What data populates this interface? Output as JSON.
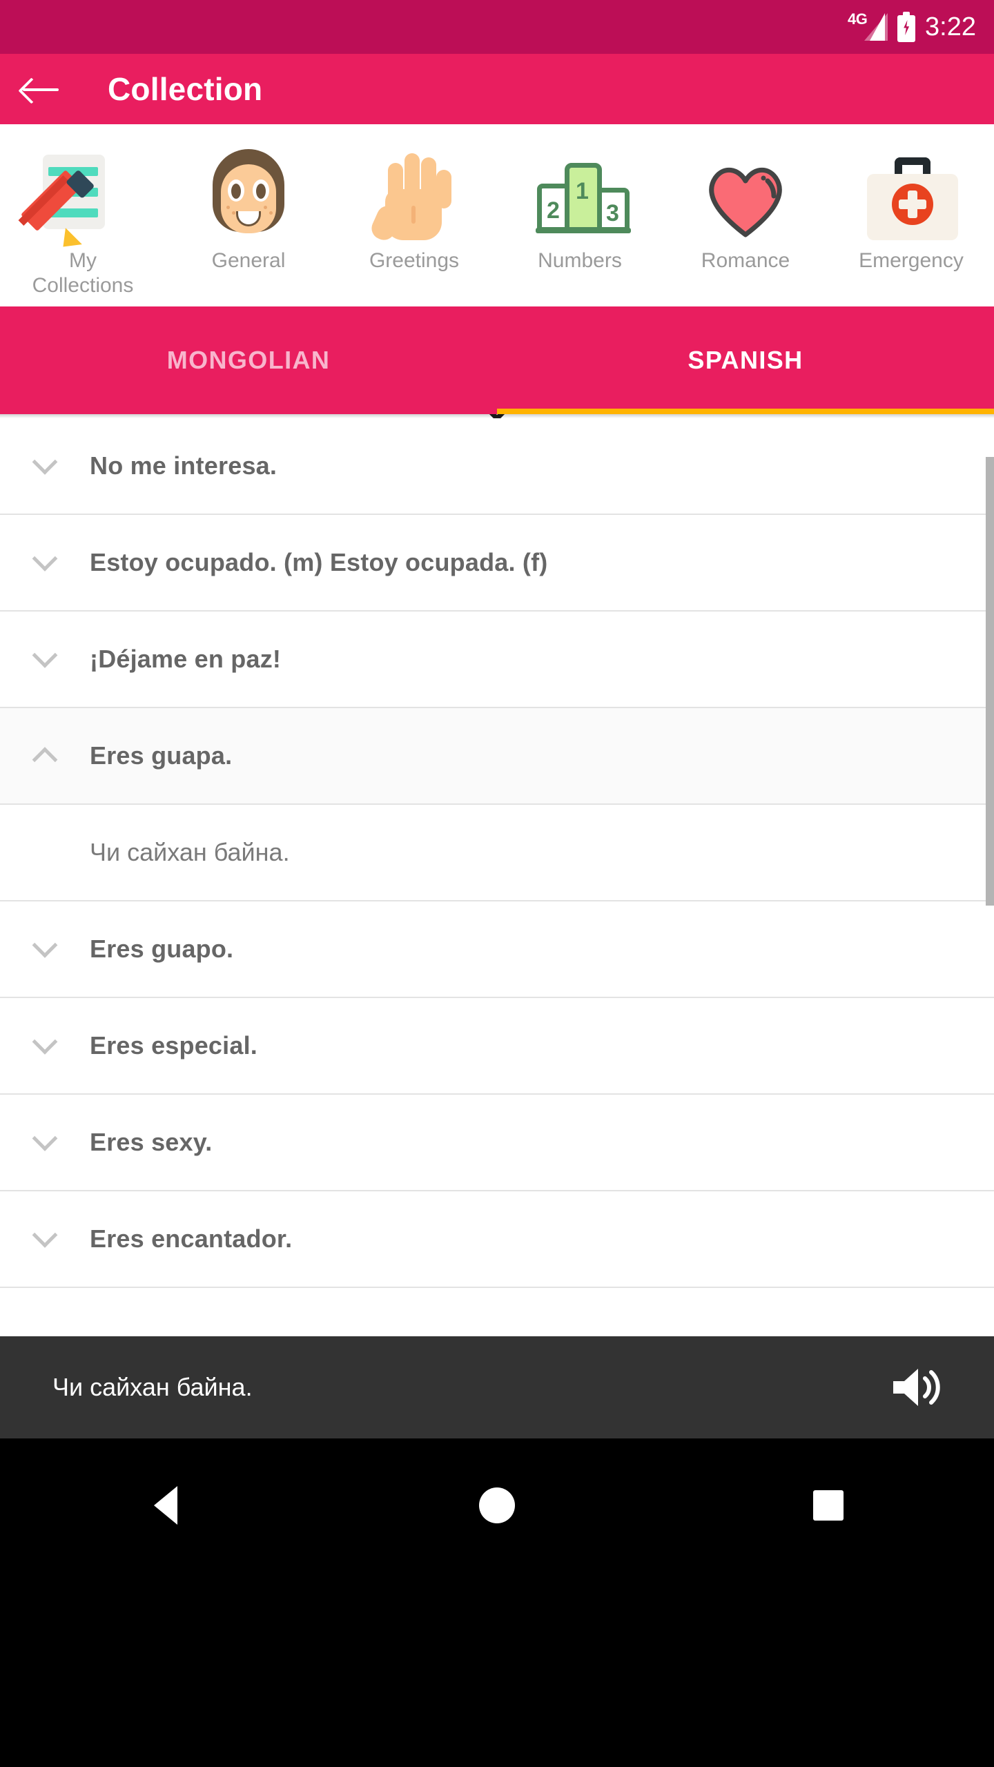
{
  "status_bar": {
    "network_label": "4G",
    "time": "3:22",
    "signal_icon": "signal-bars-icon",
    "battery_icon": "battery-charging-icon",
    "bg_color": "#bc0e56"
  },
  "app_bar": {
    "back_icon": "back-arrow-icon",
    "title": "Collection",
    "bg_color": "#e91e5f"
  },
  "categories": {
    "items": [
      {
        "label": "My Collections",
        "icon": "notepad-pencil-icon",
        "selected": false
      },
      {
        "label": "General",
        "icon": "girl-face-icon",
        "selected": false
      },
      {
        "label": "Greetings",
        "icon": "open-hand-icon",
        "selected": false
      },
      {
        "label": "Numbers",
        "icon": "podium-icon",
        "selected": false
      },
      {
        "label": "Romance",
        "icon": "heart-icon",
        "selected": true
      },
      {
        "label": "Emergency",
        "icon": "first-aid-kit-icon",
        "selected": false
      }
    ],
    "expand_icon": "chevron-down-icon",
    "podium_numbers": {
      "second": "2",
      "first": "1",
      "third": "3"
    }
  },
  "tabs": {
    "items": [
      {
        "label": "MONGOLIAN",
        "active": false
      },
      {
        "label": "SPANISH",
        "active": true
      }
    ],
    "indicator_color": "#ffb300"
  },
  "phrase_list": {
    "rows": [
      {
        "text": "No me interesa.",
        "expanded": false,
        "chevron": "chevron-down-icon"
      },
      {
        "text": "Estoy ocupado. (m)  Estoy ocupada. (f)",
        "expanded": false,
        "chevron": "chevron-down-icon"
      },
      {
        "text": "¡Déjame en paz!",
        "expanded": false,
        "chevron": "chevron-down-icon"
      },
      {
        "text": "Eres guapa.",
        "expanded": true,
        "chevron": "chevron-up-icon"
      },
      {
        "text": "Чи сайхан байна.",
        "translation": true
      },
      {
        "text": "Eres guapo.",
        "expanded": false,
        "chevron": "chevron-down-icon"
      },
      {
        "text": "Eres especial.",
        "expanded": false,
        "chevron": "chevron-down-icon"
      },
      {
        "text": "Eres sexy.",
        "expanded": false,
        "chevron": "chevron-down-icon"
      },
      {
        "text": "Eres encantador.",
        "expanded": false,
        "chevron": "chevron-down-icon"
      }
    ],
    "scrollbar_visible": true
  },
  "player": {
    "text": "Чи сайхан байна.",
    "speaker_icon": "speaker-volume-icon",
    "bg_color": "#333333"
  },
  "nav_bar": {
    "back_icon": "nav-back-triangle-icon",
    "home_icon": "nav-home-circle-icon",
    "recents_icon": "nav-recents-square-icon"
  }
}
